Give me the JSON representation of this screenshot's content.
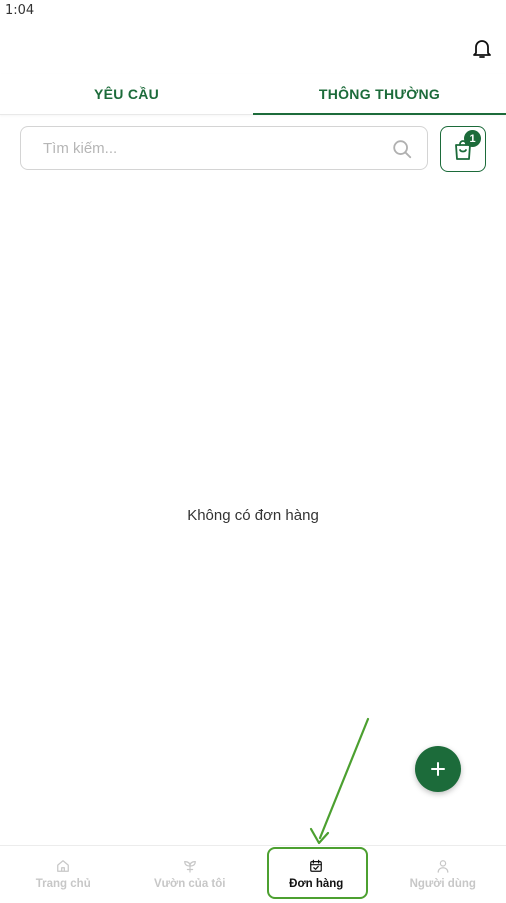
{
  "status_bar": {
    "time": "1:04"
  },
  "header": {
    "bell_icon": "bell-icon"
  },
  "tabs": [
    {
      "label": "YÊU CẦU",
      "active": false
    },
    {
      "label": "THÔNG THƯỜNG",
      "active": true
    }
  ],
  "search": {
    "placeholder": "Tìm kiếm...",
    "value": "",
    "icon": "search-icon"
  },
  "cart": {
    "icon": "shopping-bag-icon",
    "badge_count": "1"
  },
  "main": {
    "empty_message": "Không có đơn hàng"
  },
  "fab": {
    "icon": "plus-icon"
  },
  "bottom_nav": [
    {
      "label": "Trang chủ",
      "icon": "home-icon",
      "active": false
    },
    {
      "label": "Vườn của tôi",
      "icon": "plant-icon",
      "active": false
    },
    {
      "label": "Đơn hàng",
      "icon": "calendar-check-icon",
      "active": true
    },
    {
      "label": "Người dùng",
      "icon": "user-icon",
      "active": false
    }
  ],
  "colors": {
    "primary": "#1c6b3a",
    "annotation": "#4ca030",
    "inactive": "#c7c7c7"
  }
}
